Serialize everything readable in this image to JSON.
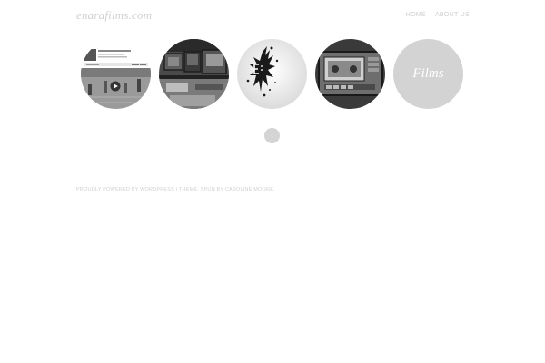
{
  "site": {
    "title": "enarafilms.com"
  },
  "nav": {
    "items": [
      {
        "label": "HOME"
      },
      {
        "label": "ABOUT US"
      }
    ]
  },
  "gallery": {
    "items": [
      {
        "icon": "video-player-thumbnail"
      },
      {
        "icon": "studio-equipment-photo"
      },
      {
        "icon": "enara-ink-splash-logo"
      },
      {
        "icon": "tape-deck-photo"
      },
      {
        "label": "Films"
      }
    ]
  },
  "pager": {
    "label": "‹"
  },
  "footer": {
    "text": "PROUDLY POWERED BY WORDPRESS | THEME: SPUN BY CAROLINE MOORE."
  },
  "colors": {
    "muted_text": "#cfcfcf",
    "films_circle": "#d3d3d3",
    "pager": "#d4d4d4"
  }
}
